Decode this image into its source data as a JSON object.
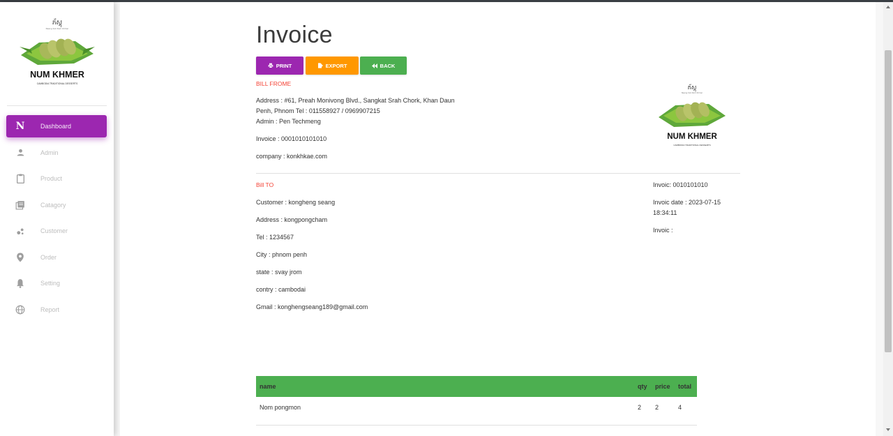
{
  "sidebar": {
    "brand": {
      "name": "NUM KHMER",
      "script": "ភ័ស្តុ",
      "tagline_small": "Neang Sok Num Khmer",
      "tagline": "CAMBODIA TRADITIONAL DESSERTS"
    },
    "items": [
      {
        "label": "Dashboard",
        "icon": "N",
        "active": true
      },
      {
        "label": "Admin",
        "icon": "person-icon"
      },
      {
        "label": "Product",
        "icon": "clipboard-icon"
      },
      {
        "label": "Catagory",
        "icon": "library-icon"
      },
      {
        "label": "Customer",
        "icon": "bubbles-icon"
      },
      {
        "label": "Order",
        "icon": "location-pin-icon"
      },
      {
        "label": "Setting",
        "icon": "bell-icon"
      },
      {
        "label": "Report",
        "icon": "globe-icon"
      }
    ]
  },
  "page": {
    "title": "Invoice",
    "buttons": {
      "print": "PRINT",
      "export": "EXPORT",
      "back": "BACK"
    },
    "colors": {
      "purple": "#9c27b0",
      "orange": "#ff9800",
      "green": "#4caf50",
      "red": "#f44336"
    }
  },
  "bill_from": {
    "label": "BILL FROME",
    "address_line1": "Address : #61, Preah Monivong Blvd., Sangkat Srah Chork, Khan Daun",
    "address_line2": "Penh, Phnom Tel : 011558927 / 0969907215",
    "admin": "Admin : Pen Techmeng",
    "invoice": "Invoice : 0001010101010",
    "company": "company : konkhkae.com"
  },
  "bill_to": {
    "label": "Bill TO",
    "customer": "Customer : kongheng seang",
    "address": "Address : kongpongcham",
    "tel": "Tel : 1234567",
    "city": "City : phnom penh",
    "state": "state : svay jrom",
    "country": "contry : cambodai",
    "gmail": "Gmail : konghengseang189@gmail.com"
  },
  "invoice_meta": {
    "invoice": "Invoic: 0010101010",
    "date_line1": "Invoic date : 2023-07-15",
    "date_line2": "18:34:11",
    "invoice_blank": "Invoic :"
  },
  "table": {
    "headers": {
      "name": "name",
      "qty": "qty",
      "price": "price",
      "total": "total"
    },
    "rows": [
      {
        "name": "Nom pongmon",
        "qty": "2",
        "price": "2",
        "total": "4"
      }
    ]
  }
}
